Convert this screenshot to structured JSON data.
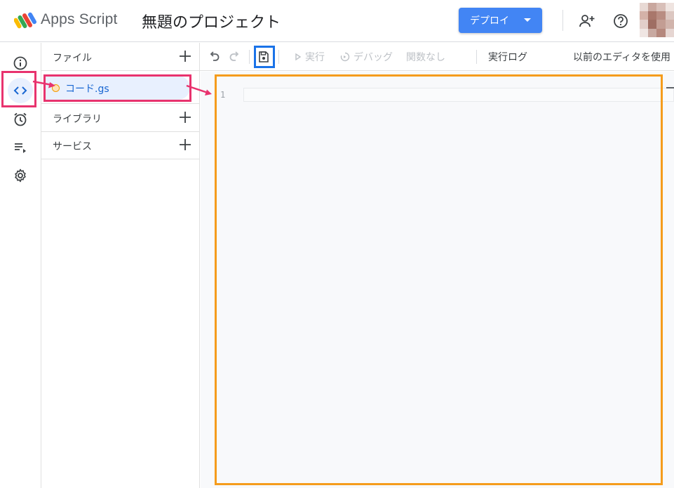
{
  "header": {
    "app_name": "Apps Script",
    "project_title": "無題のプロジェクト",
    "deploy_label": "デプロイ",
    "logo_icon": "apps-script-logo-icon",
    "add_user_icon": "person-add-icon",
    "help_icon": "help-icon",
    "brand_color": "#4285f4"
  },
  "rail": {
    "items": [
      {
        "icon": "info-icon",
        "label": "overview"
      },
      {
        "icon": "code-icon",
        "label": "editor",
        "active": true
      },
      {
        "icon": "alarm-icon",
        "label": "triggers"
      },
      {
        "icon": "playlist-play-icon",
        "label": "executions"
      },
      {
        "icon": "gear-icon",
        "label": "settings"
      }
    ]
  },
  "files_panel": {
    "files_label": "ファイル",
    "files": [
      {
        "name": "コード.gs",
        "status_color": "#f29900"
      }
    ],
    "libraries_label": "ライブラリ",
    "services_label": "サービス"
  },
  "toolbar": {
    "undo_icon": "undo-icon",
    "redo_icon": "redo-icon",
    "save_icon": "save-icon",
    "run_label": "実行",
    "debug_label": "デバッグ",
    "function_label": "関数なし",
    "log_label": "実行ログ",
    "legacy_editor_label": "以前のエディタを使用"
  },
  "editor": {
    "line_numbers": [
      "1"
    ],
    "content": ""
  },
  "annotations": {
    "pink": "#e8336e",
    "blue": "#1a73e8",
    "orange": "#f59c1c"
  }
}
